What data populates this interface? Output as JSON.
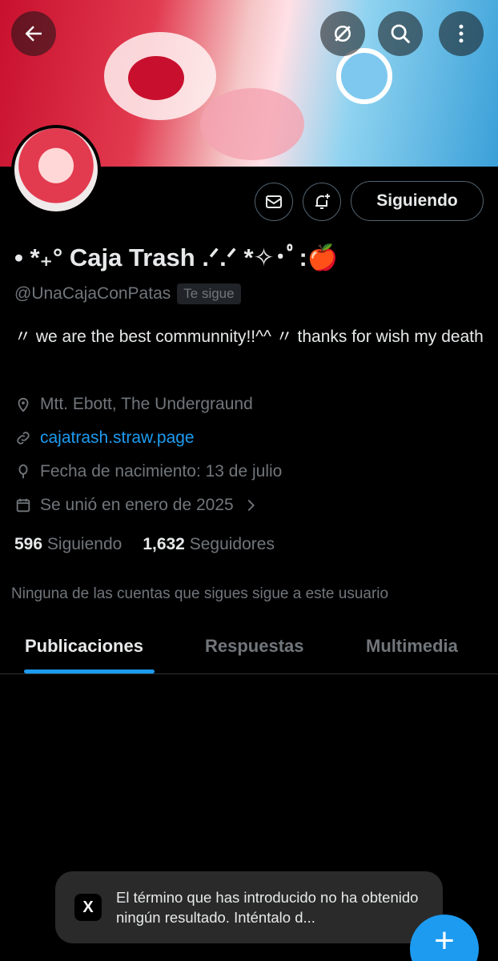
{
  "header": {
    "back_icon": "arrow-left-icon",
    "grok_icon": "grok-icon",
    "search_icon": "search-icon",
    "more_icon": "more-vertical-icon"
  },
  "profile": {
    "display_name": "• *₊° Caja Trash .ᐟ.ᐟ *✧･ﾟ:🍎",
    "handle": "@UnaCajaConPatas",
    "follows_you": "Te sigue",
    "bio": "〃 we are the best communnity!!^^ 〃  thanks for wish my death",
    "location": "Mtt. Ebott, The Undergraund",
    "website": "cajatrash.straw.page",
    "birthday": "Fecha de nacimiento: 13 de julio",
    "joined": "Se unió en enero de 2025",
    "following_count": "596",
    "following_label": "Siguiendo",
    "followers_count": "1,632",
    "followers_label": "Seguidores",
    "mutual_note": "Ninguna de las cuentas que sigues sigue a este usuario"
  },
  "actions": {
    "follow_label": "Siguiendo"
  },
  "tabs": [
    {
      "label": "Publicaciones",
      "active": true
    },
    {
      "label": "Respuestas",
      "active": false
    },
    {
      "label": "Multimedia",
      "active": false
    }
  ],
  "toast": {
    "logo": "X",
    "message": "El término que has introducido no ha obtenido ningún resultado. Inténtalo d..."
  },
  "fab": {
    "label": "+"
  },
  "colors": {
    "accent": "#1d9bf0",
    "background": "#000000",
    "muted": "#71767b"
  }
}
